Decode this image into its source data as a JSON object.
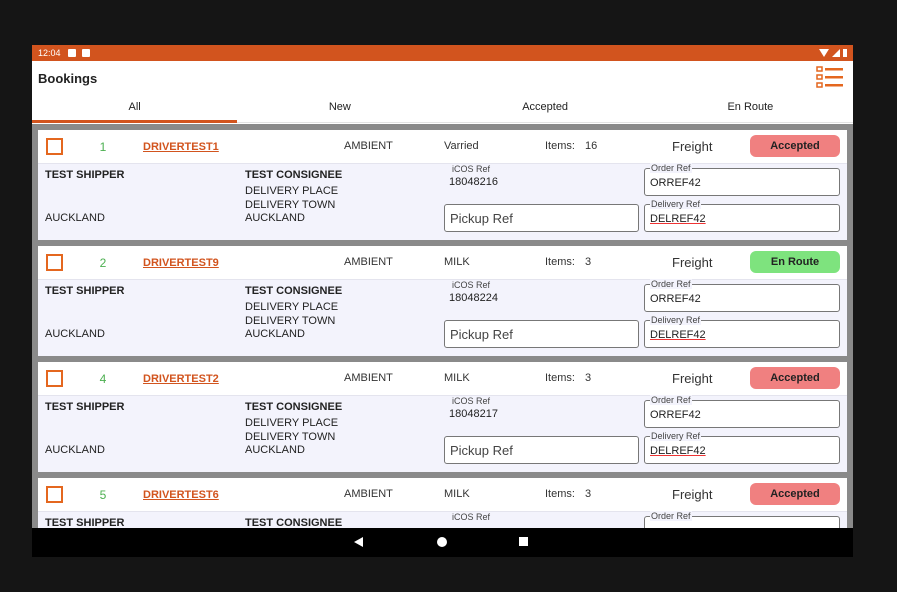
{
  "statusbar": {
    "time": "12:04",
    "icons": [
      "photo-icon",
      "sdcard-icon"
    ],
    "right_icons": [
      "wifi-icon",
      "signal-icon",
      "battery-icon"
    ]
  },
  "appbar": {
    "title": "Bookings",
    "menu_icon": "list-menu-icon"
  },
  "tabs": [
    {
      "label": "All",
      "active": true
    },
    {
      "label": "New",
      "active": false
    },
    {
      "label": "Accepted",
      "active": false
    },
    {
      "label": "En Route",
      "active": false
    }
  ],
  "labels": {
    "items": "Items:",
    "icos_ref": "iCOS Ref",
    "order_ref": "Order Ref",
    "delivery_ref": "Delivery Ref",
    "pickup_placeholder": "Pickup Ref"
  },
  "bookings": [
    {
      "number": "1",
      "driver": "DRIVERTEST1",
      "temperature": "AMBIENT",
      "product": "Varried",
      "items": "16",
      "type": "Freight",
      "status": "Accepted",
      "status_color": "#f08080",
      "shipper": "TEST SHIPPER",
      "shipper_city": "AUCKLAND",
      "consignee": "TEST CONSIGNEE",
      "consignee_line1": "DELIVERY PLACE",
      "consignee_line2": "DELIVERY TOWN",
      "consignee_city": "AUCKLAND",
      "icos_ref": "18048216",
      "order_ref": "ORREF42",
      "delivery_ref": "DELREF42"
    },
    {
      "number": "2",
      "driver": "DRIVERTEST9",
      "temperature": "AMBIENT",
      "product": "MILK",
      "items": "3",
      "type": "Freight",
      "status": "En Route",
      "status_color": "#7ee37e",
      "shipper": "TEST SHIPPER",
      "shipper_city": "AUCKLAND",
      "consignee": "TEST CONSIGNEE",
      "consignee_line1": "DELIVERY PLACE",
      "consignee_line2": "DELIVERY TOWN",
      "consignee_city": "AUCKLAND",
      "icos_ref": "18048224",
      "order_ref": "ORREF42",
      "delivery_ref": "DELREF42"
    },
    {
      "number": "4",
      "driver": "DRIVERTEST2",
      "temperature": "AMBIENT",
      "product": "MILK",
      "items": "3",
      "type": "Freight",
      "status": "Accepted",
      "status_color": "#f08080",
      "shipper": "TEST SHIPPER",
      "shipper_city": "AUCKLAND",
      "consignee": "TEST CONSIGNEE",
      "consignee_line1": "DELIVERY PLACE",
      "consignee_line2": "DELIVERY TOWN",
      "consignee_city": "AUCKLAND",
      "icos_ref": "18048217",
      "order_ref": "ORREF42",
      "delivery_ref": "DELREF42"
    },
    {
      "number": "5",
      "driver": "DRIVERTEST6",
      "temperature": "AMBIENT",
      "product": "MILK",
      "items": "3",
      "type": "Freight",
      "status": "Accepted",
      "status_color": "#f08080",
      "shipper": "TEST SHIPPER",
      "consignee": "TEST CONSIGNEE"
    }
  ],
  "navbar": {
    "icons": [
      "back-icon",
      "home-icon",
      "recents-icon"
    ]
  },
  "colors": {
    "accent": "#d2541e",
    "number_green": "#4caf50",
    "accepted": "#f08080",
    "en_route": "#7ee37e"
  }
}
